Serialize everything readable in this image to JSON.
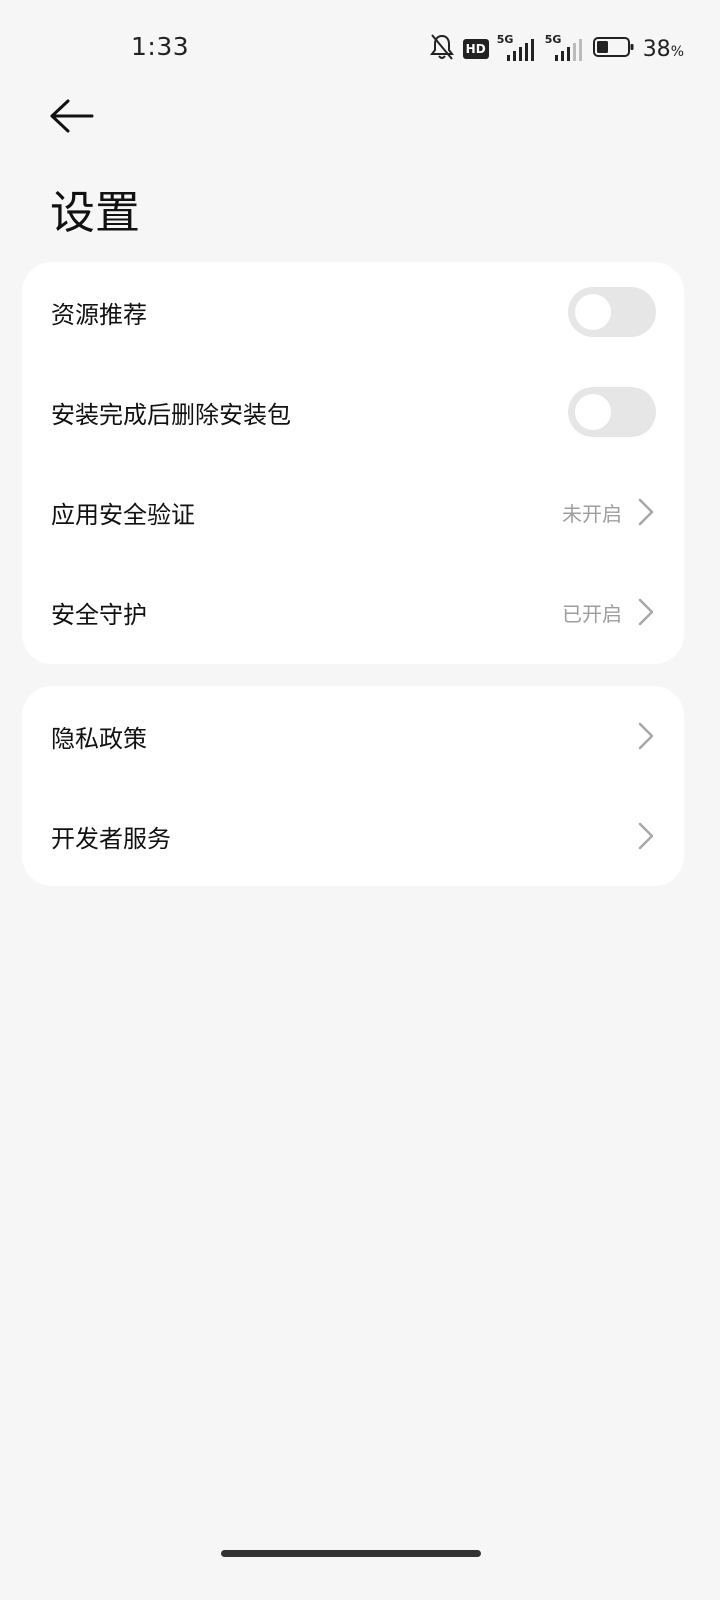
{
  "status_bar": {
    "time": "1:33",
    "hd_label": "HD",
    "network_1": "5G",
    "network_2": "5G",
    "battery_percent": "38",
    "battery_percent_sign": "%",
    "battery_level": 0.38
  },
  "header": {
    "title": "设置"
  },
  "settings_group_1": {
    "items": [
      {
        "label": "资源推荐",
        "type": "toggle",
        "on": false
      },
      {
        "label": "安装完成后删除安装包",
        "type": "toggle",
        "on": false
      },
      {
        "label": "应用安全验证",
        "type": "link",
        "status": "未开启"
      },
      {
        "label": "安全守护",
        "type": "link",
        "status": "已开启"
      }
    ]
  },
  "settings_group_2": {
    "items": [
      {
        "label": "隐私政策",
        "type": "link"
      },
      {
        "label": "开发者服务",
        "type": "link"
      }
    ]
  },
  "colors": {
    "background": "#f6f6f6",
    "card": "#ffffff",
    "toggle_off_track": "#e6e6e6",
    "secondary_text": "#9e9e9e"
  }
}
